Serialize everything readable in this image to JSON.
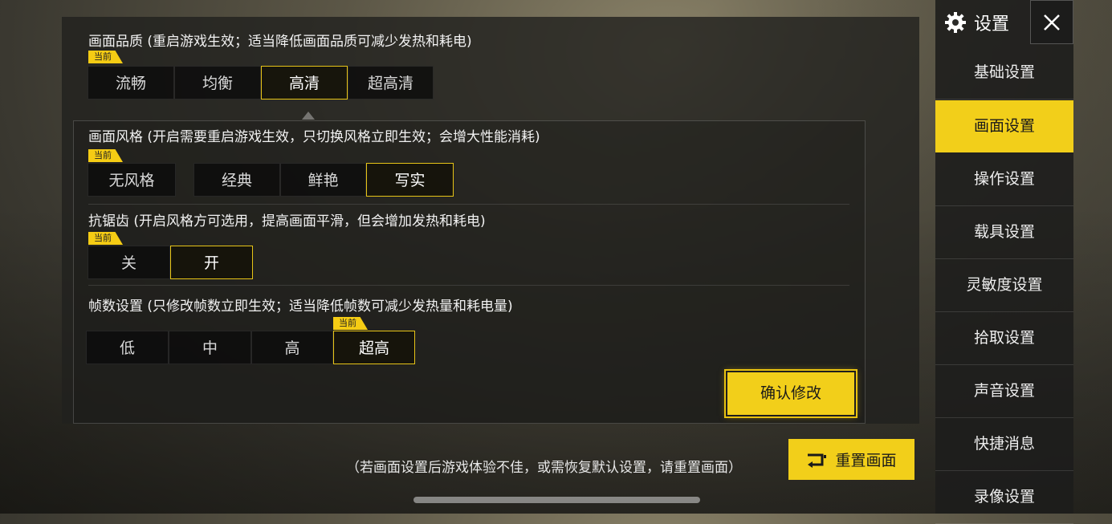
{
  "colors": {
    "accent": "#f2cf1a"
  },
  "graphics_quality": {
    "title": "画面品质 (重启游戏生效；适当降低画面品质可减少发热和耗电)",
    "current_tag": "当前",
    "options": [
      "流畅",
      "均衡",
      "高清",
      "超高清"
    ],
    "selected": "高清"
  },
  "graphics_style": {
    "title": "画面风格 (开启需要重启游戏生效，只切换风格立即生效；会增大性能消耗)",
    "current_tag": "当前",
    "options_first": [
      "无风格"
    ],
    "options": [
      "经典",
      "鲜艳",
      "写实"
    ],
    "selected": "写实"
  },
  "anti_aliasing": {
    "title": "抗锯齿 (开启风格方可选用，提高画面平滑，但会增加发热和耗电)",
    "current_tag": "当前",
    "options": [
      "关",
      "开"
    ],
    "selected": "开"
  },
  "frame_rate": {
    "title": "帧数设置 (只修改帧数立即生效；适当降低帧数可减少发热量和耗电量)",
    "current_tag": "当前",
    "options": [
      "低",
      "中",
      "高",
      "超高"
    ],
    "selected": "超高"
  },
  "confirm_label": "确认修改",
  "hint": "（若画面设置后游戏体验不佳，或需恢复默认设置，请重置画面）",
  "reset_label": "重置画面",
  "sidebar": {
    "header": "设置",
    "gear_icon": "gear-icon",
    "close_icon": "close-icon",
    "items": [
      {
        "label": "基础设置"
      },
      {
        "label": "画面设置"
      },
      {
        "label": "操作设置"
      },
      {
        "label": "载具设置"
      },
      {
        "label": "灵敏度设置"
      },
      {
        "label": "拾取设置"
      },
      {
        "label": "声音设置"
      },
      {
        "label": "快捷消息"
      },
      {
        "label": "录像设置"
      }
    ],
    "active": "画面设置"
  }
}
